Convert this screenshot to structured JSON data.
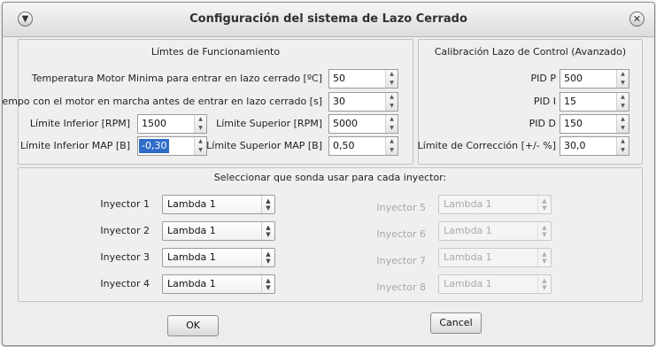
{
  "window": {
    "title": "Configuración del sistema de Lazo Cerrado",
    "menu_icon": "chevron-down-icon",
    "close_icon": "close-icon"
  },
  "limits": {
    "title": "Límtes de Funcionamiento",
    "temp_min_label": "Temperatura Motor Minima para entrar en lazo cerrado [ºC]",
    "temp_min_value": "50",
    "time_label": "Tiempo con el motor en marcha antes de entrar en lazo cerrado [s]",
    "time_value": "30",
    "lower_rpm_label": "Límite Inferior [RPM]",
    "lower_rpm_value": "1500",
    "upper_rpm_label": "Límite Superior [RPM]",
    "upper_rpm_value": "5000",
    "lower_map_label": "Límite Inferior MAP [B]",
    "lower_map_value": "-0,30",
    "upper_map_label": "Límite Superior MAP [B]",
    "upper_map_value": "0,50"
  },
  "calibration": {
    "title": "Calibración Lazo de Control (Avanzado)",
    "pid_p_label": "PID P",
    "pid_p_value": "500",
    "pid_i_label": "PID I",
    "pid_i_value": "15",
    "pid_d_label": "PID D",
    "pid_d_value": "150",
    "correction_label": "Límite de Corrección [+/- %]",
    "correction_value": "30,0"
  },
  "injectors": {
    "title": "Seleccionar que sonda usar para cada inyector:",
    "items": [
      {
        "label": "Inyector 1",
        "value": "Lambda 1",
        "enabled": true
      },
      {
        "label": "Inyector 2",
        "value": "Lambda 1",
        "enabled": true
      },
      {
        "label": "Inyector 3",
        "value": "Lambda 1",
        "enabled": true
      },
      {
        "label": "Inyector 4",
        "value": "Lambda 1",
        "enabled": true
      },
      {
        "label": "Inyector 5",
        "value": "Lambda 1",
        "enabled": false
      },
      {
        "label": "Inyector 6",
        "value": "Lambda 1",
        "enabled": false
      },
      {
        "label": "Inyector 7",
        "value": "Lambda 1",
        "enabled": false
      },
      {
        "label": "Inyector 8",
        "value": "Lambda 1",
        "enabled": false
      }
    ]
  },
  "buttons": {
    "ok": "OK",
    "cancel": "Cancel"
  }
}
